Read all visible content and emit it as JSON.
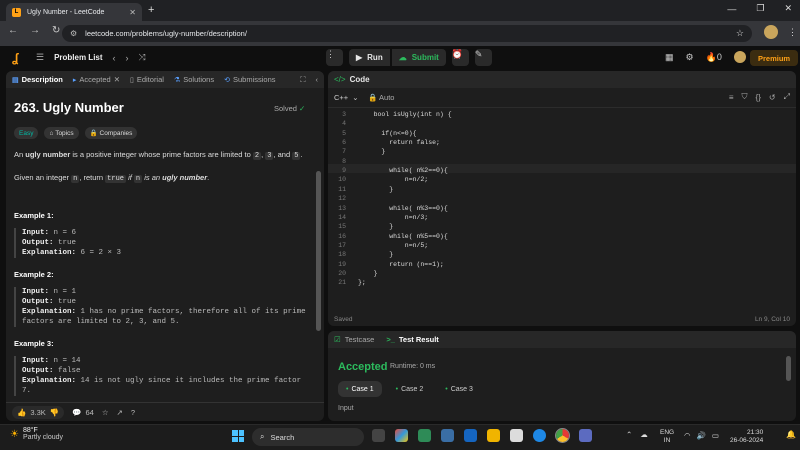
{
  "browser": {
    "tab_title": "Ugly Number - LeetCode",
    "url": "leetcode.com/problems/ugly-number/description/"
  },
  "topbar": {
    "problem_list": "Problem List",
    "run": "Run",
    "submit": "Submit",
    "streak": "0",
    "premium": "Premium"
  },
  "left_tabs": [
    "Description",
    "Accepted",
    "Editorial",
    "Solutions",
    "Submissions"
  ],
  "problem": {
    "title": "263. Ugly Number",
    "status": "Solved",
    "difficulty": "Easy",
    "topics": "Topics",
    "companies": "Companies",
    "desc1_a": "An ",
    "desc1_b": "ugly number",
    "desc1_c": " is a positive integer whose prime factors are limited to ",
    "desc1_d": "2",
    "desc1_e": ", ",
    "desc1_f": "3",
    "desc1_g": ", and ",
    "desc1_h": "5",
    "desc1_i": ".",
    "desc2_a": "Given an integer ",
    "desc2_b": "n",
    "desc2_c": ", return ",
    "desc2_d": "true",
    "desc2_e": " if ",
    "desc2_f": "n",
    "desc2_g": " is an ",
    "desc2_h": "ugly number",
    "desc2_i": "."
  },
  "examples": [
    {
      "heading": "Example 1:",
      "input": "n = 6",
      "output": "true",
      "explanation": "6 = 2 × 3"
    },
    {
      "heading": "Example 2:",
      "input": "n = 1",
      "output": "true",
      "explanation": "1 has no prime factors, therefore all of its prime factors are limited to 2, 3, and 5."
    },
    {
      "heading": "Example 3:",
      "input": "n = 14",
      "output": "false",
      "explanation": "14 is not ugly since it includes the prime factor 7."
    }
  ],
  "labels": {
    "input": "Input:",
    "output": "Output:",
    "explanation": "Explanation:"
  },
  "footer": {
    "likes": "3.3K",
    "comments": "64"
  },
  "code_panel": {
    "title": "Code",
    "language": "C++",
    "mode": "Auto",
    "saved": "Saved",
    "position": "Ln 9, Col 10"
  },
  "code_lines": [
    {
      "n": "3",
      "t": "    bool isUgly(int n) {"
    },
    {
      "n": "4",
      "t": ""
    },
    {
      "n": "5",
      "t": "      if(n<=0){"
    },
    {
      "n": "6",
      "t": "        return false;"
    },
    {
      "n": "7",
      "t": "      }"
    },
    {
      "n": "8",
      "t": ""
    },
    {
      "n": "9",
      "t": "        while( n%2==0){"
    },
    {
      "n": "10",
      "t": "            n=n/2;"
    },
    {
      "n": "11",
      "t": "        }"
    },
    {
      "n": "12",
      "t": ""
    },
    {
      "n": "13",
      "t": "        while( n%3==0){"
    },
    {
      "n": "14",
      "t": "            n=n/3;"
    },
    {
      "n": "15",
      "t": "        }"
    },
    {
      "n": "16",
      "t": "        while( n%5==0){"
    },
    {
      "n": "17",
      "t": "            n=n/5;"
    },
    {
      "n": "18",
      "t": "        }"
    },
    {
      "n": "19",
      "t": "        return (n==1);"
    },
    {
      "n": "20",
      "t": "    }"
    },
    {
      "n": "21",
      "t": "};"
    }
  ],
  "test_panel": {
    "testcase": "Testcase",
    "result": "Test Result",
    "status": "Accepted",
    "runtime": "Runtime: 0 ms",
    "cases": [
      "Case 1",
      "Case 2",
      "Case 3"
    ],
    "input_label": "Input"
  },
  "taskbar": {
    "temp": "88°F",
    "weather": "Partly cloudy",
    "search": "Search",
    "lang1": "ENG",
    "lang2": "IN",
    "time": "21:30",
    "date": "26-06-2024"
  },
  "colors": {
    "accent": "#ffa116",
    "success": "#2cbb5d",
    "easy": "#00b8a3"
  }
}
